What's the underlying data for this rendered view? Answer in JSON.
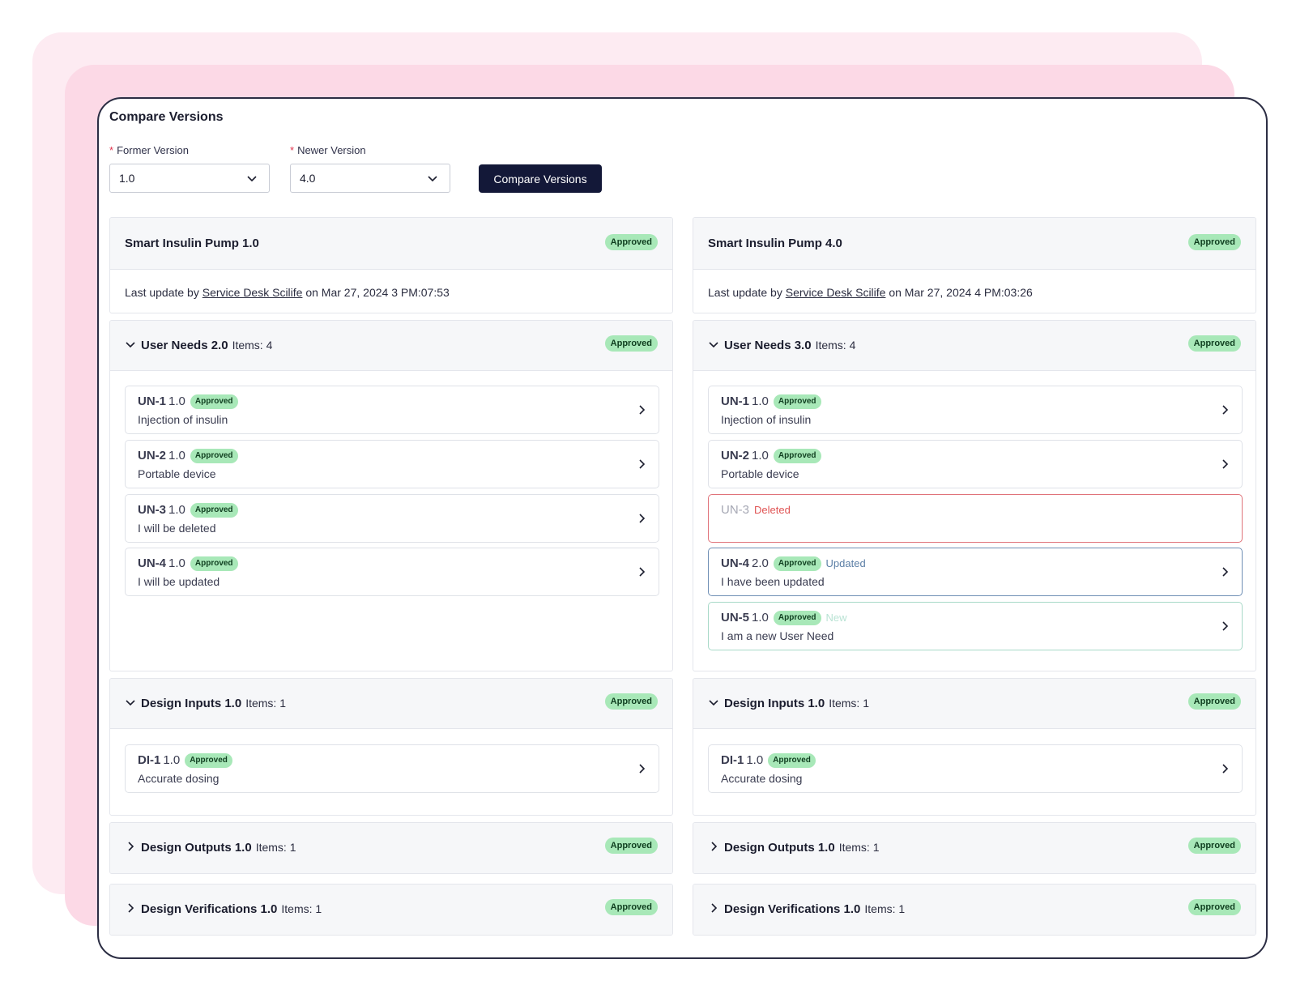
{
  "title": "Compare Versions",
  "form": {
    "former_label": "Former Version",
    "former_value": "1.0",
    "newer_label": "Newer Version",
    "newer_value": "4.0",
    "required_mark": "*",
    "compare_button": "Compare Versions"
  },
  "left": {
    "doc_title": "Smart Insulin Pump 1.0",
    "doc_status": "Approved",
    "update_prefix": "Last update by",
    "update_user": "Service Desk Scilife",
    "update_suffix": "on Mar 27, 2024 3 PM:07:53",
    "user_needs": {
      "title": "User Needs 2.0",
      "count": "Items: 4",
      "status": "Approved",
      "items": [
        {
          "code": "UN-1",
          "version": "1.0",
          "status": "Approved",
          "text": "Injection of insulin"
        },
        {
          "code": "UN-2",
          "version": "1.0",
          "status": "Approved",
          "text": "Portable device"
        },
        {
          "code": "UN-3",
          "version": "1.0",
          "status": "Approved",
          "text": "I will be deleted"
        },
        {
          "code": "UN-4",
          "version": "1.0",
          "status": "Approved",
          "text": "I will be updated"
        }
      ]
    },
    "design_inputs": {
      "title": "Design Inputs 1.0",
      "count": "Items: 1",
      "status": "Approved",
      "items": [
        {
          "code": "DI-1",
          "version": "1.0",
          "status": "Approved",
          "text": "Accurate dosing"
        }
      ]
    },
    "design_outputs": {
      "title": "Design Outputs 1.0",
      "count": "Items: 1",
      "status": "Approved"
    },
    "design_verifications": {
      "title": "Design Verifications 1.0",
      "count": "Items: 1",
      "status": "Approved"
    }
  },
  "right": {
    "doc_title": "Smart Insulin Pump 4.0",
    "doc_status": "Approved",
    "update_prefix": "Last update by",
    "update_user": "Service Desk Scilife",
    "update_suffix": "on Mar 27, 2024 4 PM:03:26",
    "user_needs": {
      "title": "User Needs 3.0",
      "count": "Items: 4",
      "status": "Approved",
      "items": [
        {
          "code": "UN-1",
          "version": "1.0",
          "status": "Approved",
          "text": "Injection of insulin"
        },
        {
          "code": "UN-2",
          "version": "1.0",
          "status": "Approved",
          "text": "Portable device"
        },
        {
          "code": "UN-3",
          "change": "Deleted"
        },
        {
          "code": "UN-4",
          "version": "2.0",
          "status": "Approved",
          "change": "Updated",
          "text": "I have been updated"
        },
        {
          "code": "UN-5",
          "version": "1.0",
          "status": "Approved",
          "change": "New",
          "text": "I am a new User Need"
        }
      ]
    },
    "design_inputs": {
      "title": "Design Inputs 1.0",
      "count": "Items: 1",
      "status": "Approved",
      "items": [
        {
          "code": "DI-1",
          "version": "1.0",
          "status": "Approved",
          "text": "Accurate dosing"
        }
      ]
    },
    "design_outputs": {
      "title": "Design Outputs 1.0",
      "count": "Items: 1",
      "status": "Approved"
    },
    "design_verifications": {
      "title": "Design Verifications 1.0",
      "count": "Items: 1",
      "status": "Approved"
    }
  },
  "colors": {
    "approved_badge": "#a8e8b8",
    "deleted": "#e05555",
    "updated": "#5c7fa6",
    "new": "#b9e3d4",
    "button": "#131838"
  },
  "icons": {
    "select_chevron": "chevron-down-icon",
    "section_expanded": "chevron-down-icon",
    "section_collapsed": "chevron-right-icon",
    "item_open": "chevron-right-icon"
  }
}
